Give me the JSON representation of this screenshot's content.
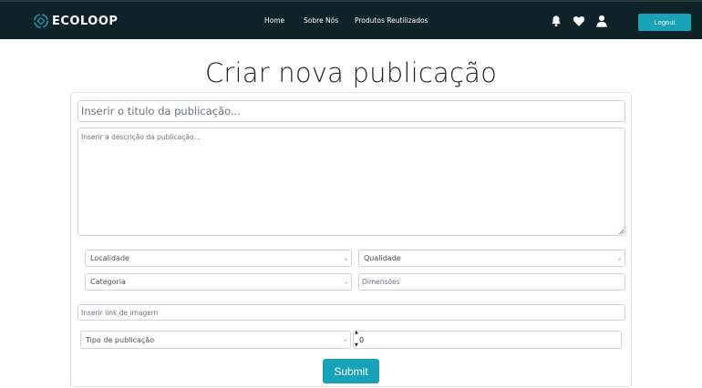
{
  "navbar": {
    "brand": "ECOLOOP",
    "links": [
      "Home",
      "Sobre Nós",
      "Produtos Reutilizados"
    ],
    "logout_label": "Logout"
  },
  "page": {
    "title": "Criar nova publicação"
  },
  "form": {
    "title_placeholder": "Inserir o titulo da publicação...",
    "description_placeholder": "Inserir a descrição da publicação...",
    "localidade": "Localidade",
    "qualidade": "Qualidade",
    "categoria": "Categoria",
    "dimensoes_placeholder": "Dimensões",
    "imagem_placeholder": "Inserir link de imagem",
    "tipo": "Tipo de publicação",
    "number_value": "0",
    "submit_label": "Submit"
  },
  "colors": {
    "navbar": "#0e2327",
    "accent": "#17a2b8"
  }
}
